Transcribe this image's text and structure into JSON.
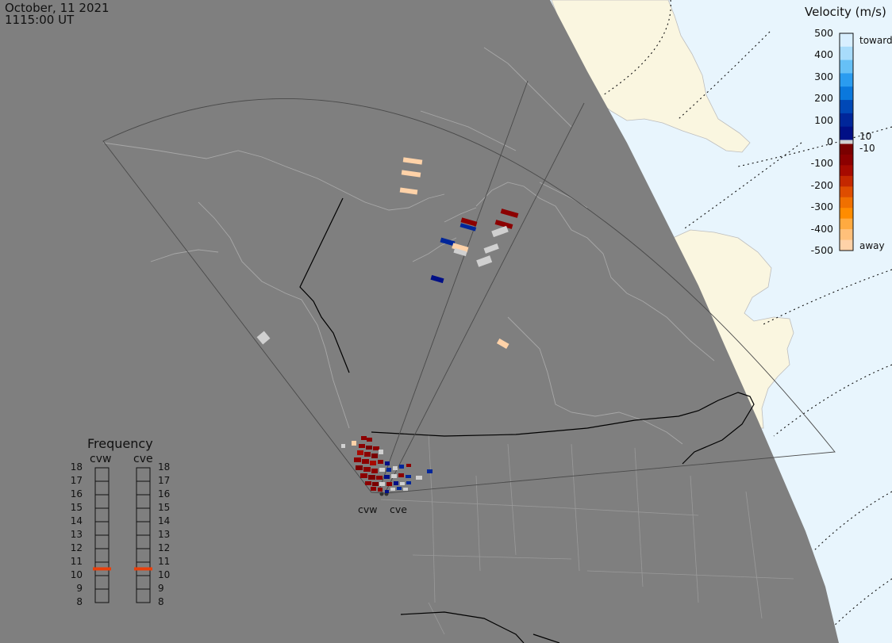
{
  "header": {
    "date": "October, 11 2021",
    "time": "1115:00 UT"
  },
  "colorbar": {
    "title": "Velocity (m/s)",
    "ticks": [
      "500",
      "400",
      "300",
      "200",
      "100",
      "0",
      "-100",
      "-200",
      "-300",
      "-400",
      "-500"
    ],
    "near_zero_labels": [
      "10",
      "-10"
    ],
    "toward_label": "toward",
    "away_label": "away",
    "colors": [
      "#d8efff",
      "#a8dcfb",
      "#66c0f6",
      "#2a9cf0",
      "#0a78dd",
      "#0048b6",
      "#00269a",
      "#000f86",
      "#d0d0d0",
      "#7a0000",
      "#8c0000",
      "#a60a00",
      "#c42800",
      "#de4d00",
      "#f07000",
      "#ff8c00",
      "#ffaa40",
      "#ffc07a",
      "#ffd2a8"
    ]
  },
  "frequency": {
    "title": "Frequency",
    "radars": [
      "cvw",
      "cve"
    ],
    "ticks": [
      "18",
      "17",
      "16",
      "15",
      "14",
      "13",
      "12",
      "11",
      "10",
      "9",
      "8"
    ],
    "current_mhz": [
      10.5,
      10.5
    ],
    "marker_color": "#e8400c"
  },
  "radars": {
    "labels": [
      "cvw",
      "cve"
    ]
  },
  "colors": {
    "night": "#7f7f7f",
    "land_day": "#faf6e0",
    "ocean_day": "#e8f5fd",
    "coast": "#a8a8a8",
    "border": "#000000",
    "fov": "#4a4a4a"
  }
}
